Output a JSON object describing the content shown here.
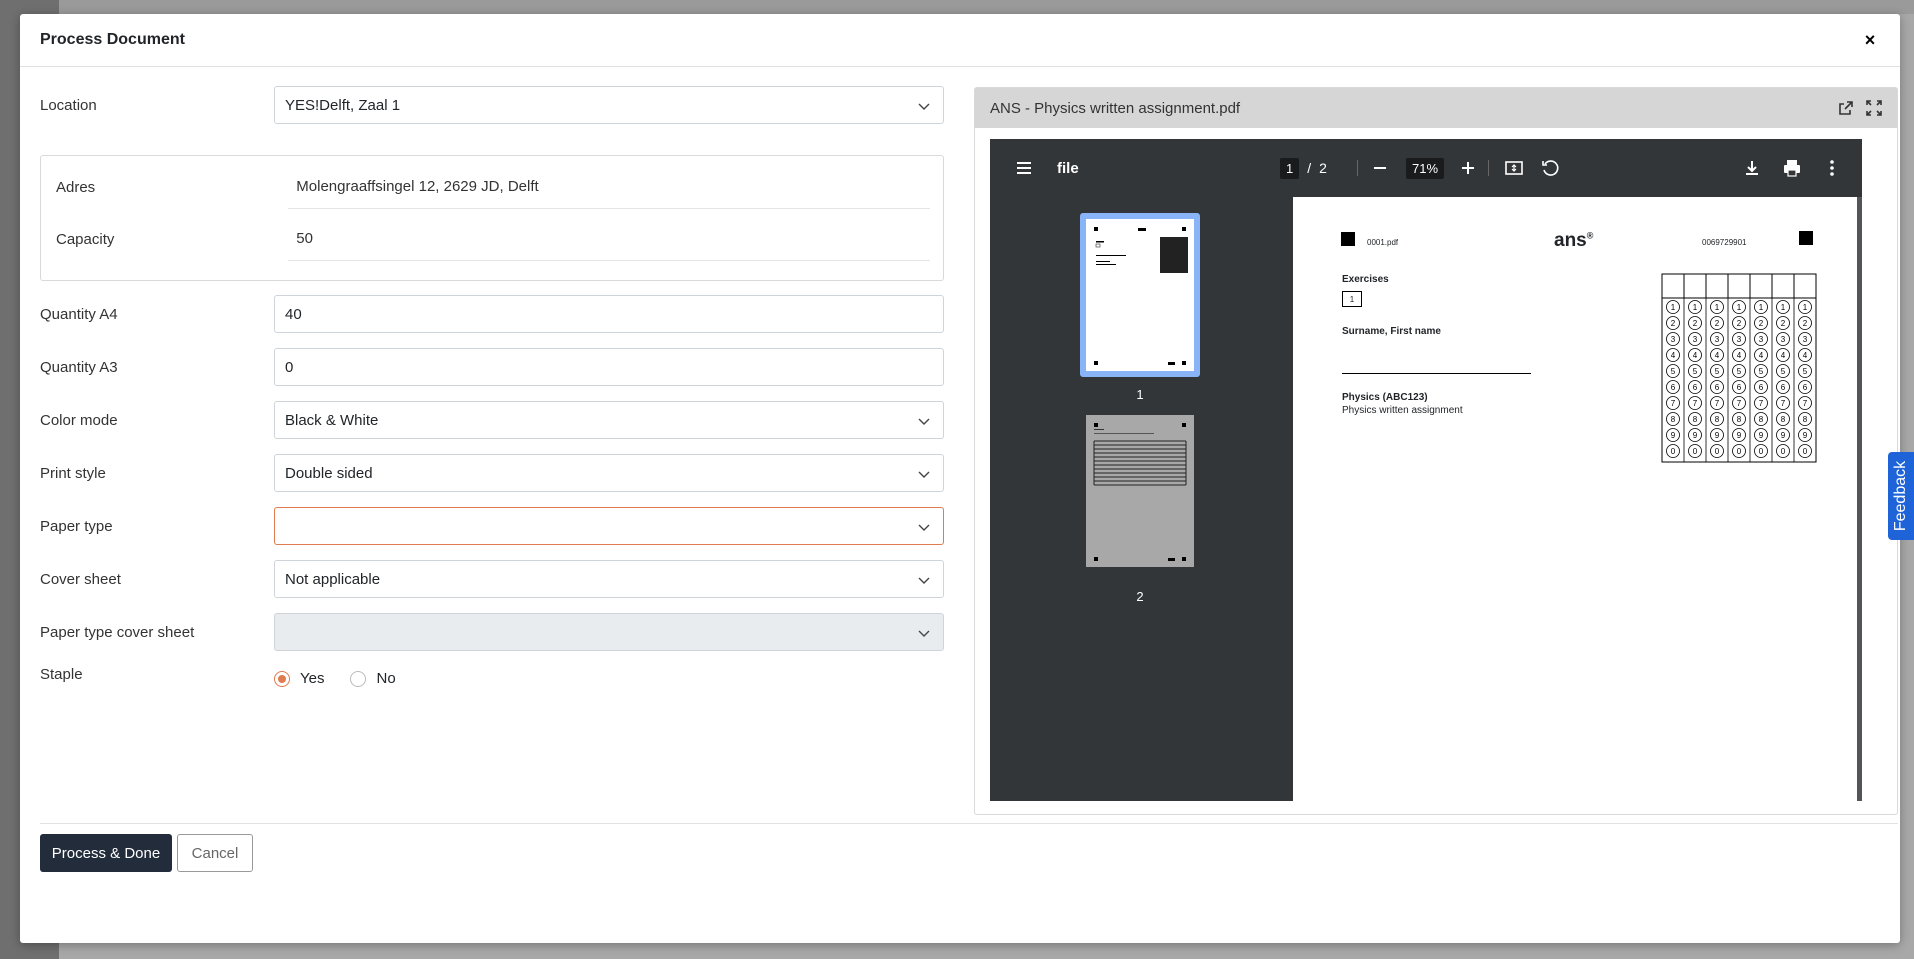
{
  "modal": {
    "title": "Process Document",
    "close_glyph": "×"
  },
  "form": {
    "location": {
      "label": "Location",
      "value": "YES!Delft, Zaal 1"
    },
    "address": {
      "label": "Adres",
      "value": "Molengraaffsingel 12, 2629 JD, Delft"
    },
    "capacity": {
      "label": "Capacity",
      "value": "50"
    },
    "quantity_a4": {
      "label": "Quantity A4",
      "value": "40"
    },
    "quantity_a3": {
      "label": "Quantity A3",
      "value": "0"
    },
    "color_mode": {
      "label": "Color mode",
      "value": "Black & White"
    },
    "print_style": {
      "label": "Print style",
      "value": "Double sided"
    },
    "paper_type": {
      "label": "Paper type",
      "value": ""
    },
    "cover_sheet": {
      "label": "Cover sheet",
      "value": "Not applicable"
    },
    "paper_type_cover": {
      "label": "Paper type cover sheet",
      "value": ""
    },
    "staple": {
      "label": "Staple",
      "options": [
        "Yes",
        "No"
      ],
      "selected": "Yes"
    }
  },
  "viewer": {
    "filename": "ANS - Physics written assignment.pdf",
    "toolbar": {
      "title": "file",
      "current_page": "1",
      "page_sep": "/",
      "total_pages": "2",
      "zoom": "71%"
    },
    "thumbnails": [
      "1",
      "2"
    ],
    "page": {
      "file_ref": "0001.pdf",
      "logo": "ans",
      "logo_mark": "®",
      "doc_number": "0069729901",
      "exercises_label": "Exercises",
      "exercise_number": "1",
      "name_label": "Surname, First name",
      "course": "Physics (ABC123)",
      "assignment": "Physics written assignment"
    }
  },
  "footer": {
    "primary": "Process & Done",
    "cancel": "Cancel"
  },
  "feedback_tab": "Feedback",
  "colors": {
    "primary_button": "#232c3b",
    "accent": "#e07a4f",
    "feedback": "#1e64d8",
    "pdf_toolbar": "#323639"
  }
}
